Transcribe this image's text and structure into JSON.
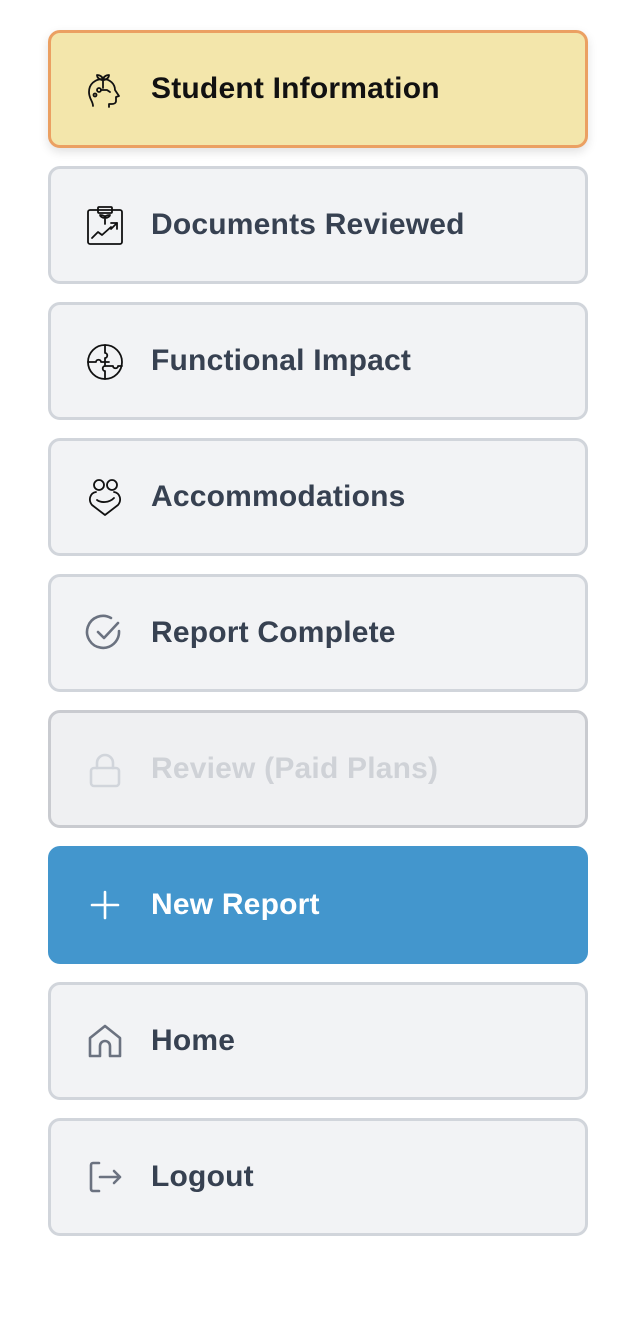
{
  "nav": {
    "items": [
      {
        "label": "Student Information",
        "icon": "head-sprout-icon",
        "state": "active"
      },
      {
        "label": "Documents Reviewed",
        "icon": "clipboard-chart-icon",
        "state": "default"
      },
      {
        "label": "Functional Impact",
        "icon": "puzzle-head-icon",
        "state": "default"
      },
      {
        "label": "Accommodations",
        "icon": "heart-hug-icon",
        "state": "default"
      },
      {
        "label": "Report Complete",
        "icon": "check-circle-icon",
        "state": "default"
      },
      {
        "label": "Review (Paid Plans)",
        "icon": "lock-icon",
        "state": "disabled"
      },
      {
        "label": "New Report",
        "icon": "plus-icon",
        "state": "primary"
      },
      {
        "label": "Home",
        "icon": "home-icon",
        "state": "default"
      },
      {
        "label": "Logout",
        "icon": "logout-icon",
        "state": "default"
      }
    ]
  },
  "colors": {
    "active_bg": "#f3e6ab",
    "active_border": "#eba062",
    "primary": "#4396cd",
    "text": "#374151"
  }
}
